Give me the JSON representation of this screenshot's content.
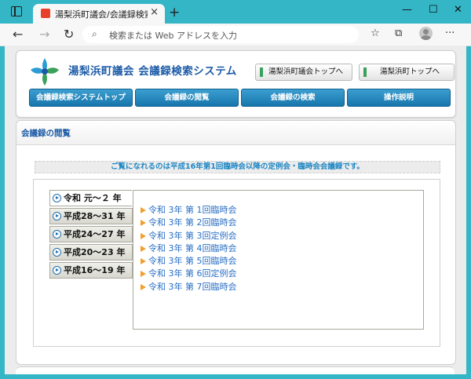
{
  "browser": {
    "tab_title": "湯梨浜町議会/会議録検索システム",
    "tab_close": "×",
    "new_tab": "+",
    "address_placeholder": "検索または Web アドレスを入力",
    "icons": [
      "sidebar-toggle-icon",
      "back-icon",
      "forward-icon",
      "refresh-icon",
      "search-icon",
      "favorites-icon",
      "collections-icon",
      "profile-icon",
      "more-icon"
    ]
  },
  "header": {
    "site_title": "湯梨浜町議会 会議録検索システム",
    "top_links": [
      {
        "label": "湯梨浜町議会トップへ"
      },
      {
        "label": "湯梨浜町トップへ"
      }
    ],
    "nav": [
      {
        "label": "会議録検索システムトップ"
      },
      {
        "label": "会議録の閲覧"
      },
      {
        "label": "会議録の検索"
      },
      {
        "label": "操作説明"
      }
    ]
  },
  "content": {
    "section_title": "会議録の閲覧",
    "notice": "ご覧になれるのは平成16年第1回臨時会以降の定例会・臨時会会議録です。",
    "years": [
      {
        "label": "令和 元～２ 年",
        "active": true
      },
      {
        "label": "平成28～31 年"
      },
      {
        "label": "平成24～27 年"
      },
      {
        "label": "平成20～23 年"
      },
      {
        "label": "平成16～19 年"
      }
    ],
    "meetings": [
      "令和 3年 第 1回臨時会",
      "令和 3年 第 2回臨時会",
      "令和 3年 第 3回定例会",
      "令和 3年 第 4回臨時会",
      "令和 3年 第 5回臨時会",
      "令和 3年 第 6回定例会",
      "令和 3年 第 7回臨時会"
    ]
  },
  "colors": {
    "accent": "#1b5aa6",
    "nav_button": "#1776ad",
    "notice_text": "#1d86c4",
    "link": "#2a6fc4",
    "window_frame": "#34b6c6"
  }
}
